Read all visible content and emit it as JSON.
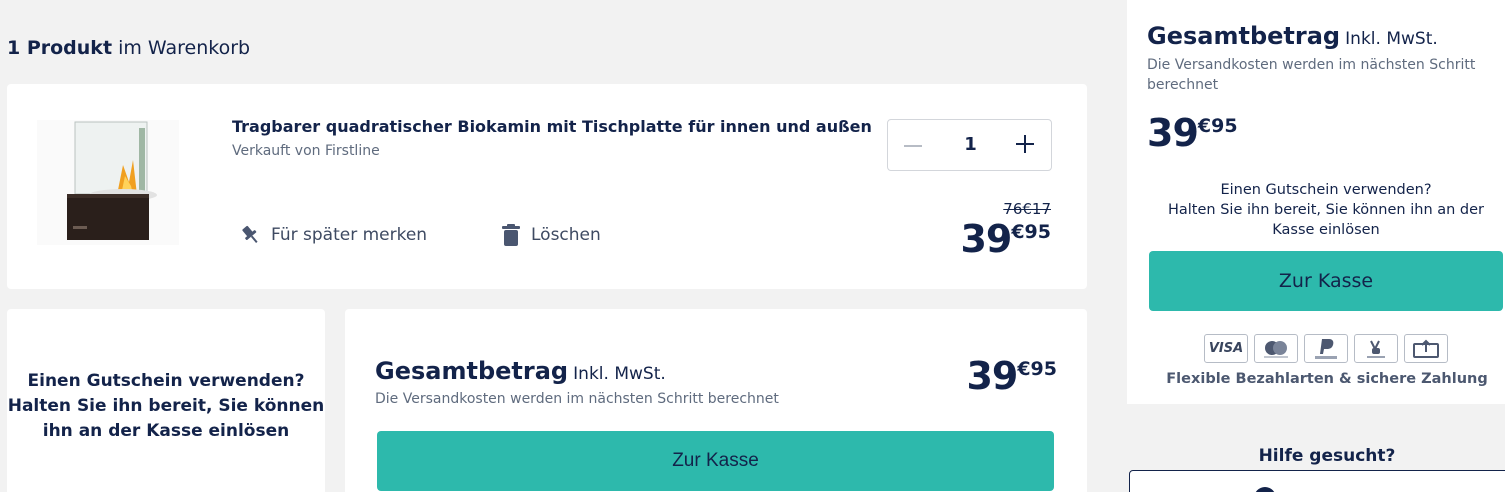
{
  "cart": {
    "count": "1 Produkt",
    "suffix": "im Warenkorb"
  },
  "product": {
    "name": "Tragbarer quadratischer Biokamin mit Tischplatte für innen und außen",
    "seller": "Verkauft von Firstline",
    "quantity": "1",
    "old_price": "76€17",
    "price_big": "39",
    "price_small": "€95",
    "save_later_label": "Für später merken",
    "delete_label": "Löschen"
  },
  "coupon": {
    "text": "Einen Gutschein verwenden? Halten Sie ihn bereit, Sie können ihn an der Kasse einlösen",
    "side_line1": "Einen Gutschein verwenden?",
    "side_line2": "Halten Sie ihn bereit, Sie können ihn an der Kasse einlösen"
  },
  "total": {
    "label": "Gesamtbetrag",
    "vat": "Inkl. MwSt.",
    "shipping_note": "Die Versandkosten werden im nächsten Schritt berechnet",
    "price_big": "39",
    "price_small": "€95",
    "checkout_label": "Zur Kasse"
  },
  "payments": {
    "methods": [
      "VISA",
      "mastercard",
      "PayPal",
      "Sofort.",
      "Überweisung"
    ],
    "note": "Flexible Bezahlarten & sichere Zahlung"
  },
  "help": {
    "title": "Hilfe gesucht?"
  },
  "colors": {
    "accent": "#2db9ac",
    "text": "#13234a",
    "background": "#f2f2f2"
  }
}
